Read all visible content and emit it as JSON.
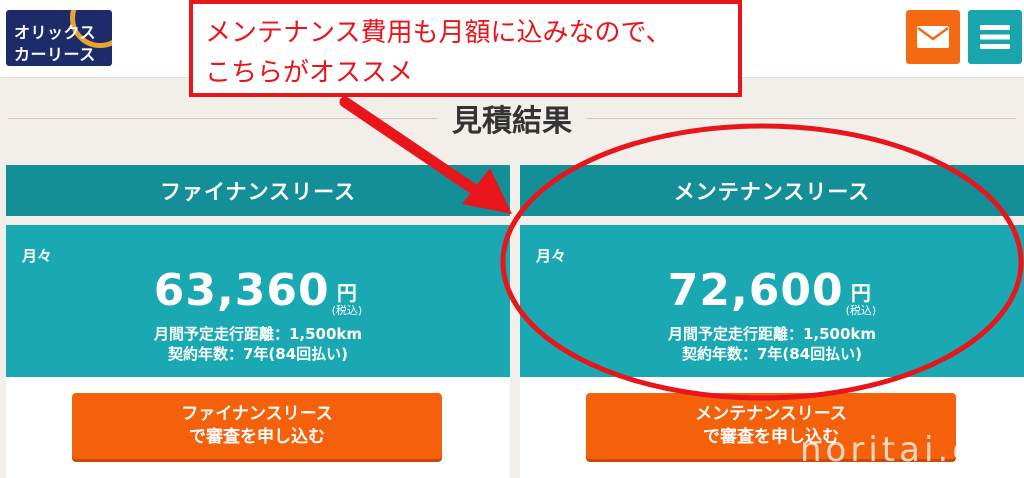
{
  "header": {
    "logo_line1": "オリックス",
    "logo_line2": "カーリース",
    "mail_icon": "envelope-icon",
    "menu_icon": "hamburger-menu-icon"
  },
  "section_title": "見積結果",
  "plans": [
    {
      "name": "ファイナンスリース",
      "per_month_label": "月々",
      "price": "63,360",
      "yen": "円",
      "tax": "(税込)",
      "mileage": "月間予定走行距離：1,500km",
      "contract": "契約年数：7年(84回払い)",
      "button_line1": "ファイナンスリース",
      "button_line2": "で審査を申し込む"
    },
    {
      "name": "メンテナンスリース",
      "per_month_label": "月々",
      "price": "72,600",
      "yen": "円",
      "tax": "(税込)",
      "mileage": "月間予定走行距離：1,500km",
      "contract": "契約年数：7年(84回払い)",
      "button_line1": "メンテナンスリース",
      "button_line2": "で審査を申し込む"
    }
  ],
  "annotation": {
    "line1": "メンテナンス費用も月額に込みなので、",
    "line2": "こちらがオススメ"
  },
  "watermark": "noritai.c",
  "colors": {
    "header_teal": "#148f98",
    "body_teal": "#1aa8b3",
    "orange": "#f5600a",
    "annotation_red": "#e8151b",
    "logo_navy": "#1d2b6b"
  }
}
